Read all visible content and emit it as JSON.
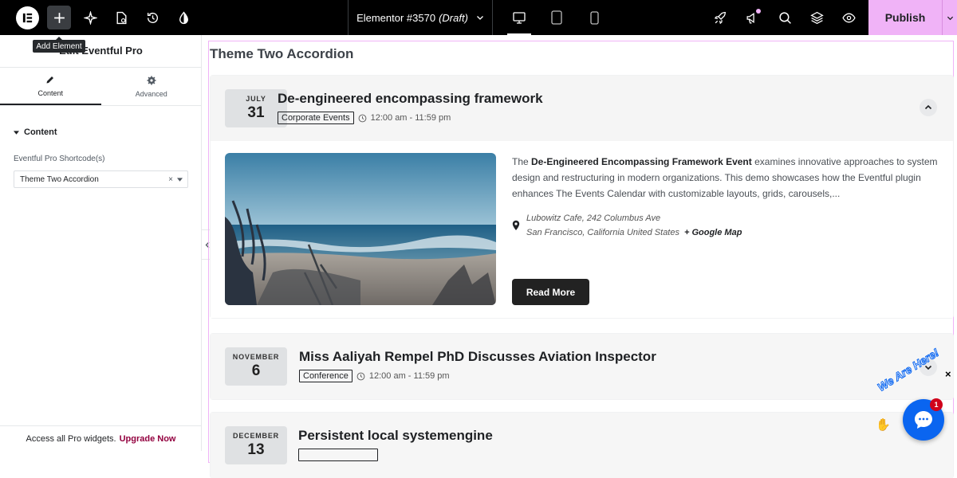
{
  "topbar": {
    "add_tooltip": "Add Element",
    "document_name": "Elementor #3570",
    "document_status": "(Draft)",
    "publish_label": "Publish"
  },
  "panel": {
    "title": "Edit Eventful Pro",
    "tabs": [
      {
        "label": "Content",
        "icon": "pencil-icon",
        "active": true
      },
      {
        "label": "Advanced",
        "icon": "gear-icon",
        "active": false
      }
    ],
    "section_label": "Content",
    "field_label": "Eventful Pro Shortcode(s)",
    "field_value": "Theme Two Accordion",
    "promo_text": "Access all Pro widgets.",
    "promo_link": "Upgrade Now"
  },
  "preview": {
    "widget_title": "Theme Two Accordion",
    "events": [
      {
        "month": "JULY",
        "day": "31",
        "title": "De-engineered encompassing framework",
        "category": "Corporate Events",
        "time": "12:00 am - 11:59 pm",
        "expanded": true,
        "desc_pre": "The ",
        "desc_bold": "De-Engineered Encompassing Framework Event",
        "desc_post": " examines innovative approaches to system design and restructuring in modern organizations. This demo showcases how the Eventful plugin enhances The Events Calendar with customizable layouts, grids, carousels,...",
        "venue": "Lubowitz Cafe, 242 Columbus Ave",
        "city": "San Francisco, California United States",
        "map_link": "+ Google Map",
        "button": "Read More"
      },
      {
        "month": "NOVEMBER",
        "day": "6",
        "title": "Miss Aaliyah Rempel PhD Discusses Aviation Inspector",
        "category": "Conference",
        "time": "12:00 am - 11:59 pm",
        "expanded": false
      },
      {
        "month": "DECEMBER",
        "day": "13",
        "title": "Persistent local systemengine",
        "expanded": false
      }
    ]
  },
  "chat": {
    "badge_count": "1",
    "greeting": "We Are Here!",
    "close": "×"
  },
  "colors": {
    "accent_pink": "#f0b3f7",
    "promo_link": "#93003f",
    "chat_blue": "#0a65f0"
  }
}
